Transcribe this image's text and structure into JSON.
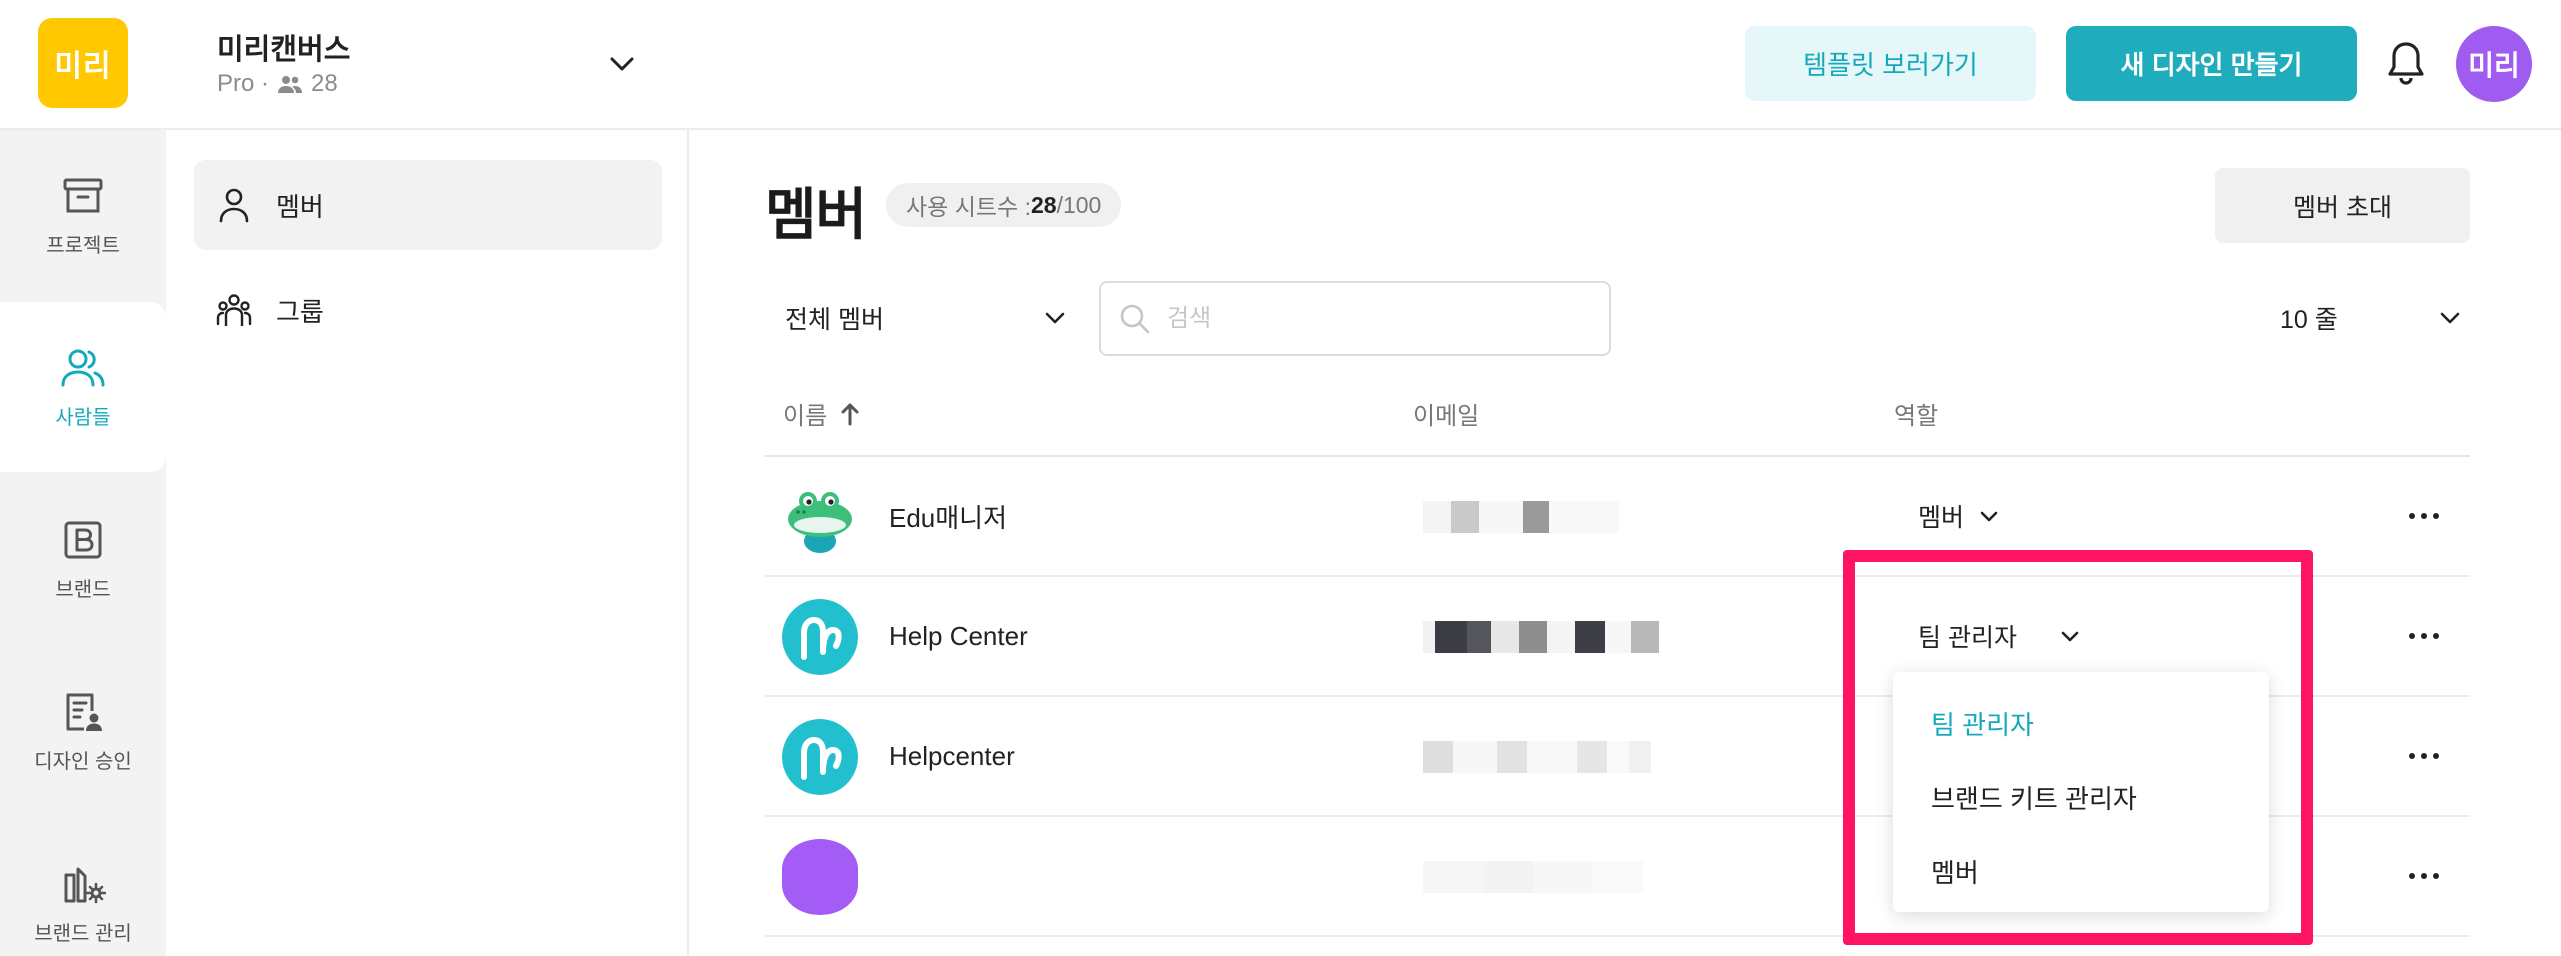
{
  "topbar": {
    "logo_text": "미리",
    "workspace_name": "미리캔버스",
    "plan": "Pro ·",
    "member_count": "28",
    "template_button": "템플릿 보러가기",
    "new_design_button": "새 디자인 만들기",
    "avatar_text": "미리"
  },
  "rail": {
    "items": [
      {
        "label": "프로젝트",
        "icon": "archive-box-icon"
      },
      {
        "label": "사람들",
        "icon": "people-icon"
      },
      {
        "label": "브랜드",
        "icon": "brand-b-icon"
      },
      {
        "label": "디자인 승인",
        "icon": "document-approval-icon"
      },
      {
        "label": "브랜드 관리",
        "icon": "brand-manage-icon"
      }
    ]
  },
  "subnav": {
    "items": [
      {
        "label": "멤버",
        "icon": "person-icon"
      },
      {
        "label": "그룹",
        "icon": "group-icon"
      }
    ]
  },
  "main": {
    "title": "멤버",
    "seat_label": "사용 시트수 :",
    "seat_used": "28",
    "seat_total": "/100",
    "invite_button": "멤버 초대",
    "filter_value": "전체 멤버",
    "search_placeholder": "검색",
    "rows_value": "10 줄",
    "columns": {
      "name": "이름",
      "email": "이메일",
      "role": "역할"
    }
  },
  "members": [
    {
      "name": "Edu매니저",
      "role": "멤버"
    },
    {
      "name": "Help Center",
      "role": "팀 관리자"
    },
    {
      "name": "Helpcenter",
      "role": ""
    },
    {
      "name": "",
      "role": ""
    }
  ],
  "role_menu": {
    "options": [
      "팀 관리자",
      "브랜드 키트 관리자",
      "멤버"
    ],
    "selected": "팀 관리자"
  },
  "colors": {
    "accent": "#1fadbd",
    "logo": "#ffc800",
    "avatar": "#a05bf0",
    "highlight": "#ff1463"
  }
}
